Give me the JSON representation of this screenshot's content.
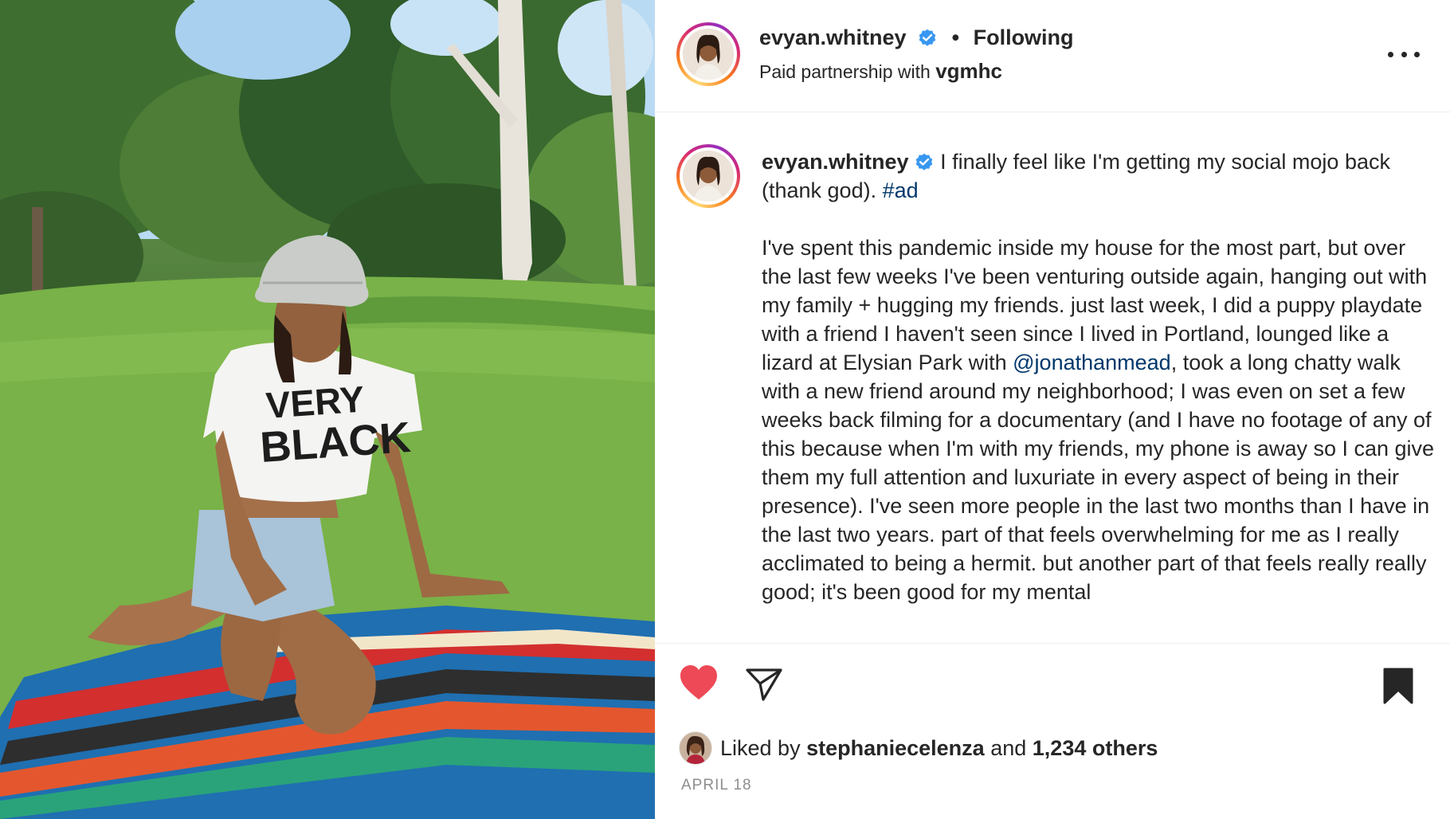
{
  "post": {
    "username": "evyan.whitney",
    "separator": "•",
    "follow_status": "Following",
    "partnership_prefix": "Paid partnership with",
    "partner": "vgmhc"
  },
  "caption": {
    "username": "evyan.whitney",
    "intro": "I finally feel like I'm getting my social mojo back (thank god).",
    "hashtag": "#ad",
    "body_before_mention": "I've spent this pandemic inside my house for the most part, but over the last few weeks I've been venturing outside again, hanging out with my family + hugging my friends. just last week, I did a puppy playdate with a friend I haven't seen since I lived in Portland, lounged like a lizard at Elysian Park with",
    "mention": "@jonathanmead",
    "body_after_mention": ", took a long chatty walk with a new friend around my neighborhood; I was even on set a few weeks back filming for a documentary (and I have no footage of any of this because when I'm with my friends, my phone is away so I can give them my full attention and luxuriate in every aspect of being in their presence). I've seen more people in the last two months than I have in the last two years. part of that feels overwhelming for me as I really acclimated to being a hermit. but another part of that feels really really good; it's been good for my mental"
  },
  "photo": {
    "shirt_text_line1": "VERY",
    "shirt_text_line2": "BLACK"
  },
  "likes": {
    "prefix": "Liked by",
    "liker": "stephaniecelenza",
    "middle": "and",
    "count_text": "1,234 others"
  },
  "date": "APRIL 18",
  "colors": {
    "like": "#ed4956",
    "link": "#00376b",
    "verified": "#3897f0",
    "muted": "#8e8e8e"
  },
  "icons": {
    "like": "heart-filled-icon",
    "share": "paper-plane-icon",
    "save": "bookmark-filled-icon",
    "more": "more-horizontal-icon",
    "verified": "verified-badge-icon"
  }
}
